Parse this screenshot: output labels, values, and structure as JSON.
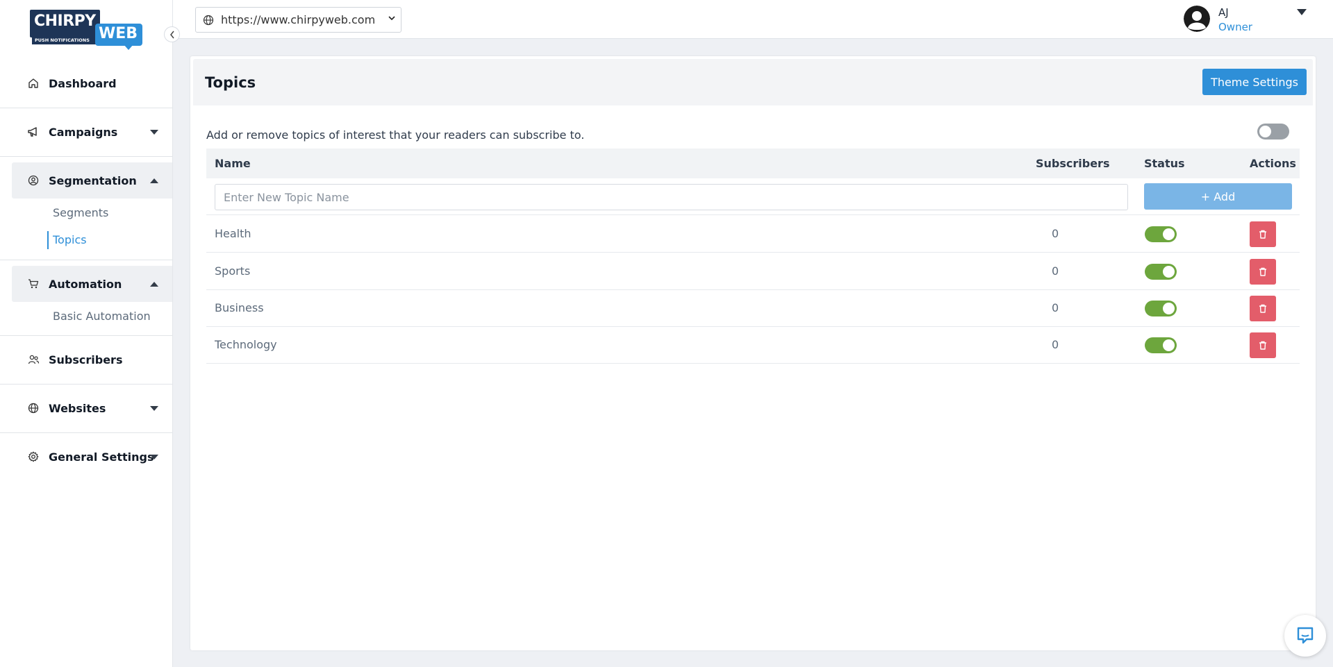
{
  "logo": {
    "top": "CHIRPY",
    "sub": "PUSH NOTIFICATIONS",
    "web": "WEB"
  },
  "sidebar": {
    "items": [
      {
        "label": "Dashboard",
        "icon": "home-icon"
      },
      {
        "label": "Campaigns",
        "icon": "megaphone-icon"
      },
      {
        "label": "Segmentation",
        "icon": "user-circle-icon",
        "children": [
          "Segments",
          "Topics"
        ]
      },
      {
        "label": "Automation",
        "icon": "cart-icon",
        "children": [
          "Basic Automation"
        ]
      },
      {
        "label": "Subscribers",
        "icon": "users-icon"
      },
      {
        "label": "Websites",
        "icon": "globe-icon"
      },
      {
        "label": "General Settings",
        "icon": "gear-icon"
      }
    ],
    "active_child": "Topics"
  },
  "topbar": {
    "site_url": "https://www.chirpyweb.com",
    "user_name": "AJ",
    "user_role": "Owner"
  },
  "page": {
    "title": "Topics",
    "theme_button": "Theme Settings",
    "description": "Add or remove topics of interest that your readers can subscribe to.",
    "master_toggle_on": false
  },
  "table": {
    "headers": {
      "name": "Name",
      "subscribers": "Subscribers",
      "status": "Status",
      "actions": "Actions"
    },
    "input_placeholder": "Enter New Topic Name",
    "add_button": "+ Add",
    "rows": [
      {
        "name": "Health",
        "subscribers": "0",
        "status": true
      },
      {
        "name": "Sports",
        "subscribers": "0",
        "status": true
      },
      {
        "name": "Business",
        "subscribers": "0",
        "status": true
      },
      {
        "name": "Technology",
        "subscribers": "0",
        "status": true
      }
    ]
  },
  "colors": {
    "brand_blue": "#2e8fd8",
    "brand_navy": "#1e3557",
    "toggle_on": "#6da63d",
    "delete_red": "#e35d6a"
  }
}
